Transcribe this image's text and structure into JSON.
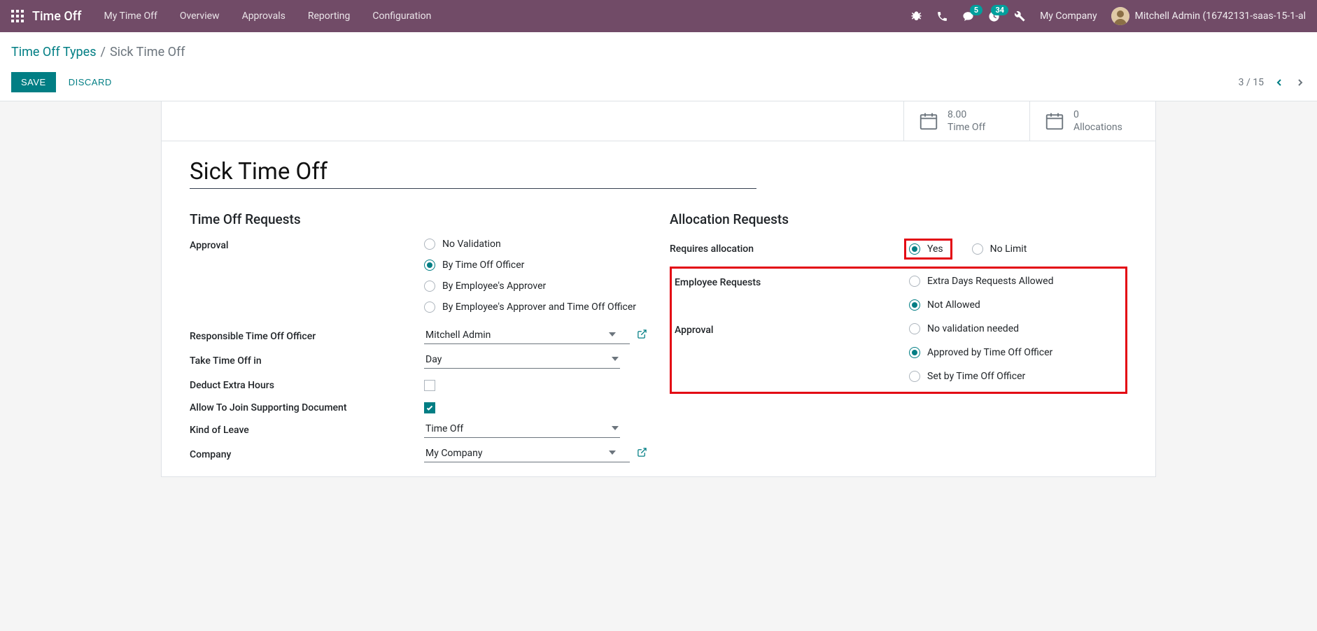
{
  "navbar": {
    "brand": "Time Off",
    "menu": [
      "My Time Off",
      "Overview",
      "Approvals",
      "Reporting",
      "Configuration"
    ],
    "messages_badge": "5",
    "activities_badge": "34",
    "company": "My Company",
    "user": "Mitchell Admin (16742131-saas-15-1-al"
  },
  "breadcrumb": {
    "parent": "Time Off Types",
    "current": "Sick Time Off"
  },
  "buttons": {
    "save": "Save",
    "discard": "Discard"
  },
  "pager": {
    "text": "3 / 15"
  },
  "stats": {
    "timeoff_value": "8.00",
    "timeoff_label": "Time Off",
    "alloc_value": "0",
    "alloc_label": "Allocations"
  },
  "form": {
    "title": "Sick Time Off",
    "left": {
      "heading": "Time Off Requests",
      "approval_label": "Approval",
      "approval_options": [
        "No Validation",
        "By Time Off Officer",
        "By Employee's Approver",
        "By Employee's Approver and Time Off Officer"
      ],
      "responsible_label": "Responsible Time Off Officer",
      "responsible_value": "Mitchell Admin",
      "unit_label": "Take Time Off in",
      "unit_value": "Day",
      "deduct_label": "Deduct Extra Hours",
      "support_label": "Allow To Join Supporting Document",
      "kind_label": "Kind of Leave",
      "kind_value": "Time Off",
      "company_label": "Company",
      "company_value": "My Company"
    },
    "right": {
      "heading": "Allocation Requests",
      "requires_label": "Requires allocation",
      "requires_options": [
        "Yes",
        "No Limit"
      ],
      "employee_label": "Employee Requests",
      "employee_options": [
        "Extra Days Requests Allowed",
        "Not Allowed"
      ],
      "approval_label": "Approval",
      "approval_options": [
        "No validation needed",
        "Approved by Time Off Officer",
        "Set by Time Off Officer"
      ]
    }
  }
}
